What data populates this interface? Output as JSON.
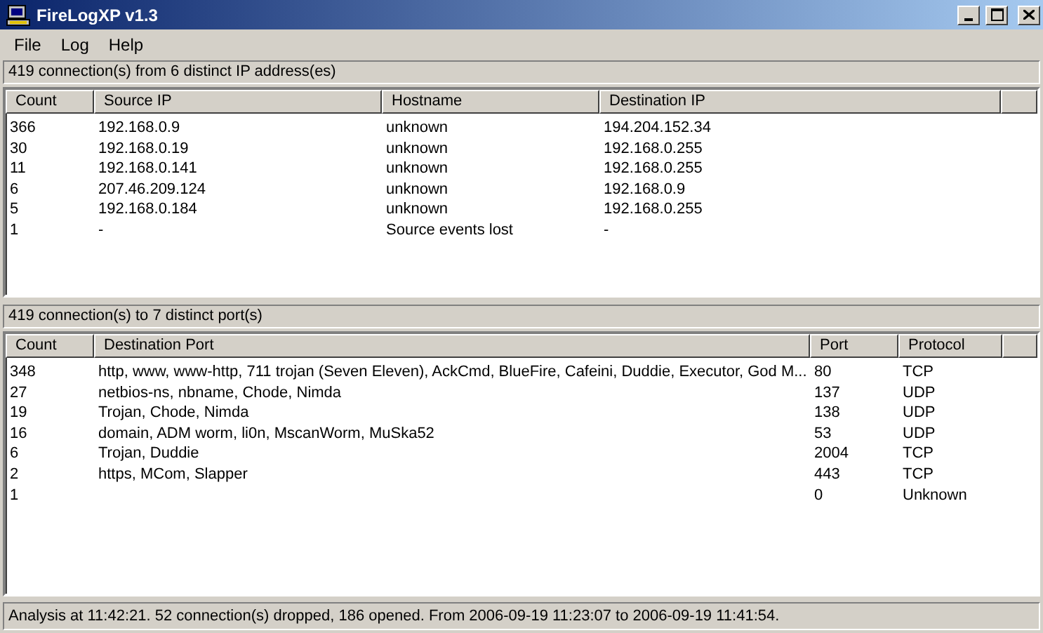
{
  "window": {
    "title": "FireLogXP v1.3"
  },
  "menu": [
    "File",
    "Log",
    "Help"
  ],
  "ip_panel": {
    "summary": "419 connection(s) from 6 distinct IP address(es)",
    "columns": [
      "Count",
      "Source IP",
      "Hostname",
      "Destination IP"
    ],
    "rows": [
      [
        "366",
        "192.168.0.9",
        "unknown",
        "194.204.152.34"
      ],
      [
        "30",
        "192.168.0.19",
        "unknown",
        "192.168.0.255"
      ],
      [
        "11",
        "192.168.0.141",
        "unknown",
        "192.168.0.255"
      ],
      [
        "6",
        "207.46.209.124",
        "unknown",
        "192.168.0.9"
      ],
      [
        "5",
        "192.168.0.184",
        "unknown",
        "192.168.0.255"
      ],
      [
        "1",
        "-",
        "Source events lost",
        "-"
      ]
    ]
  },
  "port_panel": {
    "summary": "419 connection(s) to 7 distinct port(s)",
    "columns": [
      "Count",
      "Destination Port",
      "Port",
      "Protocol"
    ],
    "rows": [
      [
        "348",
        "http, www, www-http, 711 trojan (Seven Eleven), AckCmd, BlueFire, Cafeini, Duddie, Executor, God M...",
        "80",
        "TCP"
      ],
      [
        "27",
        "netbios-ns, nbname, Chode, Nimda",
        "137",
        "UDP"
      ],
      [
        "19",
        "Trojan, Chode, Nimda",
        "138",
        "UDP"
      ],
      [
        "16",
        "domain, ADM worm, li0n, MscanWorm, MuSka52",
        "53",
        "UDP"
      ],
      [
        "6",
        "Trojan, Duddie",
        "2004",
        "TCP"
      ],
      [
        "2",
        "https, MCom, Slapper",
        "443",
        "TCP"
      ],
      [
        "1",
        "",
        "0",
        "Unknown"
      ]
    ]
  },
  "status_bar": "Analysis at 11:42:21. 52 connection(s) dropped, 186 opened. From 2006-09-19 11:23:07 to 2006-09-19 11:41:54."
}
